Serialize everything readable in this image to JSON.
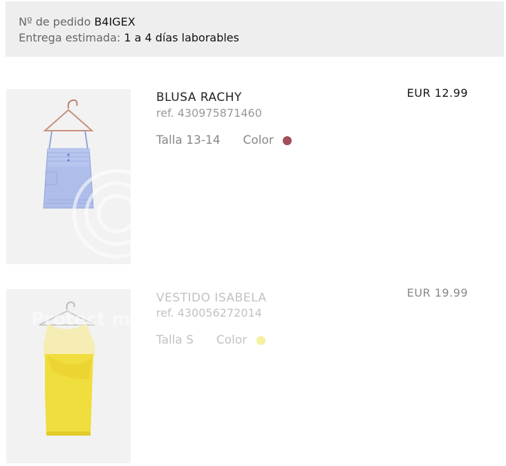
{
  "order": {
    "number_label": "Nº de pedido",
    "number_value": "B4IGEX",
    "delivery_label": "Entrega estimada:",
    "delivery_value": "1 a 4 días laborables"
  },
  "items": [
    {
      "name": "BLUSA RACHY",
      "ref": "ref. 430975871460",
      "size": "Talla 13-14",
      "color_label": "Color",
      "color_hex": "#a24f5b",
      "price": "EUR 12.99"
    },
    {
      "name": "VESTIDO ISABELA",
      "ref": "ref. 430056272014",
      "size": "Talla S",
      "color_label": "Color",
      "color_hex": "#f6f0a0",
      "price": "EUR 19.99"
    }
  ],
  "watermark_text": "Protect more"
}
